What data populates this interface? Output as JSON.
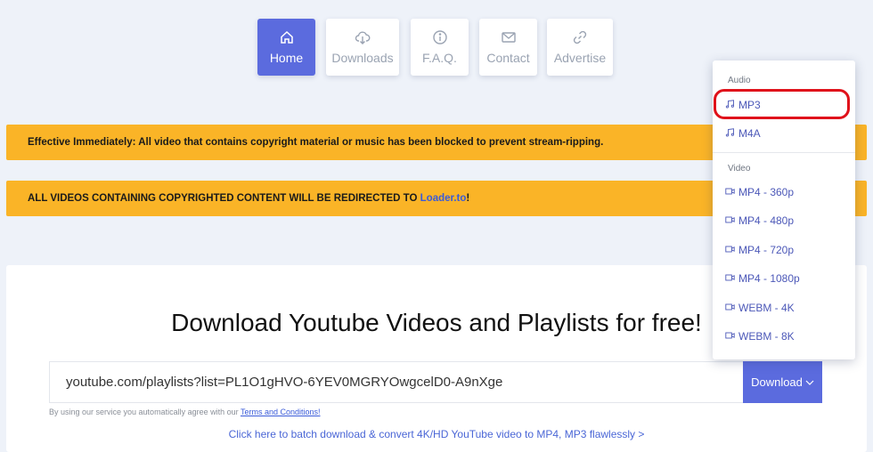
{
  "nav": {
    "items": [
      {
        "label": "Home",
        "icon": "home-icon"
      },
      {
        "label": "Downloads",
        "icon": "cloud-download-icon"
      },
      {
        "label": "F.A.Q.",
        "icon": "info-icon"
      },
      {
        "label": "Contact",
        "icon": "mail-icon"
      },
      {
        "label": "Advertise",
        "icon": "link-icon"
      }
    ]
  },
  "banners": {
    "notice": "Effective Immediately: All video that contains copyright material or music has been blocked to prevent stream-ripping.",
    "redirect_text": "ALL VIDEOS CONTAINING COPYRIGHTED CONTENT WILL BE REDIRECTED TO ",
    "redirect_link": "Loader.to",
    "redirect_suffix": "!"
  },
  "main": {
    "headline": "Download Youtube Videos and Playlists for free!",
    "url_value": "youtube.com/playlists?list=PL1O1gHVO-6YEV0MGRYOwgcelD0-A9nXge",
    "download_label": "Download",
    "terms_text": "By using our service you automatically agree with our ",
    "terms_link": "Terms and Conditions!",
    "batch_link": "Click here to batch download & convert 4K/HD YouTube video to MP4, MP3 flawlessly >"
  },
  "menu": {
    "audio_heading": "Audio",
    "video_heading": "Video",
    "audio": [
      "MP3",
      "M4A"
    ],
    "video": [
      "MP4 - 360p",
      "MP4 - 480p",
      "MP4 - 720p",
      "MP4 - 1080p",
      "WEBM - 4K",
      "WEBM - 8K"
    ],
    "highlighted": "MP3"
  },
  "colors": {
    "accent": "#5b6bde",
    "banner": "#fab427",
    "link": "#3a5bd9",
    "highlight_outline": "#e0121b",
    "background": "#eef2f9"
  }
}
